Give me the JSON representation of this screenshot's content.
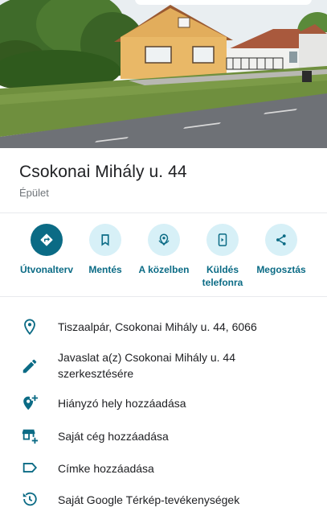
{
  "place": {
    "title": "Csokonai Mihály u. 44",
    "category": "Épület"
  },
  "colors": {
    "accent": "#0b6b85",
    "accent_light": "#d7f0f7",
    "text_primary": "#202124",
    "text_secondary": "#70757a"
  },
  "actions": [
    {
      "label": "Útvonalterv",
      "icon": "directions-icon"
    },
    {
      "label": "Mentés",
      "icon": "bookmark-icon"
    },
    {
      "label": "A közelben",
      "icon": "nearby-icon"
    },
    {
      "label": "Küldés telefonra",
      "icon": "send-to-phone-icon"
    },
    {
      "label": "Megosztás",
      "icon": "share-icon"
    }
  ],
  "info_rows": [
    {
      "text": "Tiszaalpár, Csokonai Mihály u. 44, 6066",
      "icon": "location-pin-icon"
    },
    {
      "text": "Javaslat a(z) Csokonai Mihály u. 44 szerkesztésére",
      "icon": "pencil-icon"
    },
    {
      "text": "Hiányzó hely hozzáadása",
      "icon": "add-place-icon"
    },
    {
      "text": "Saját cég hozzáadása",
      "icon": "add-business-icon"
    },
    {
      "text": "Címke hozzáadása",
      "icon": "label-icon"
    },
    {
      "text": "Saját Google Térkép-tevékenységek",
      "icon": "history-icon"
    }
  ]
}
